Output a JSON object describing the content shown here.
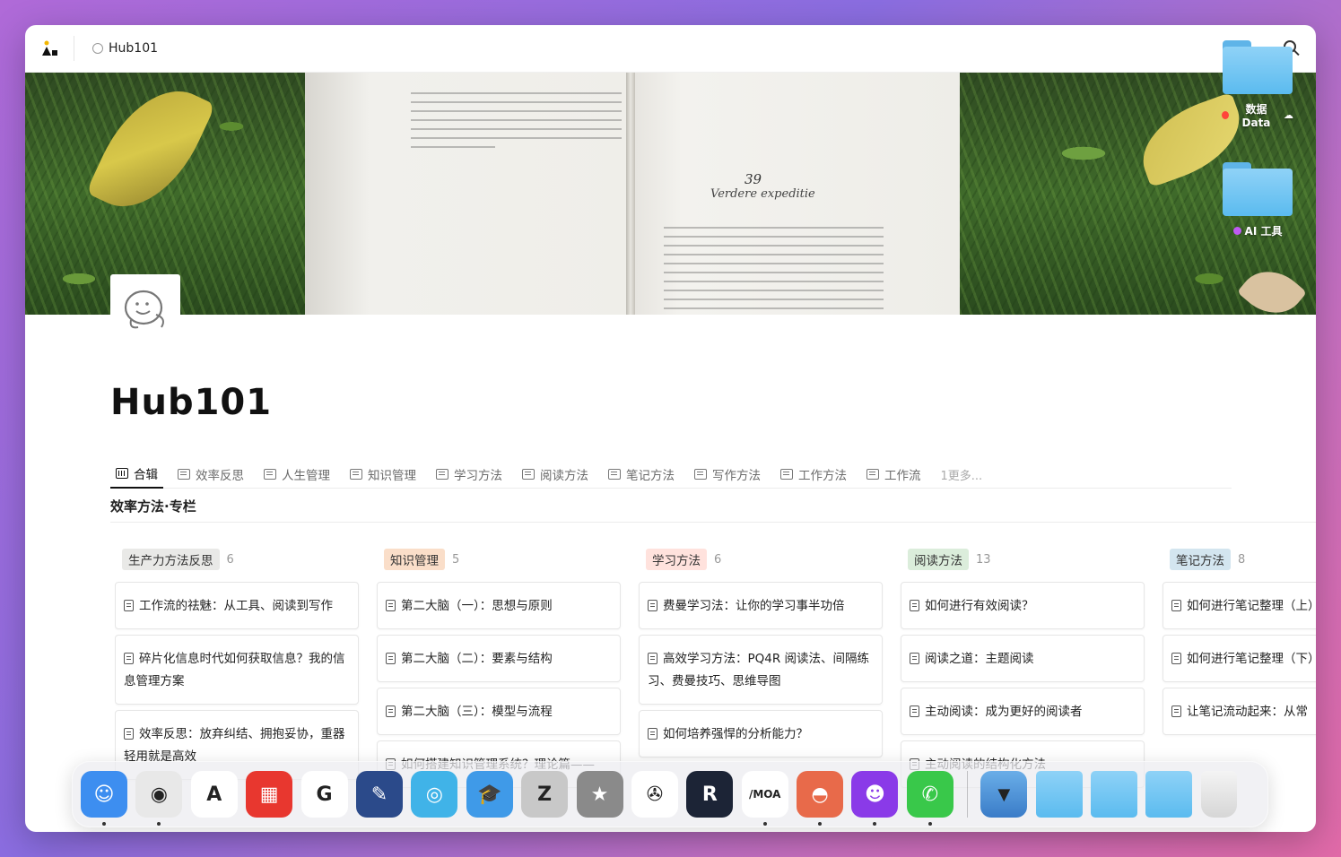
{
  "window": {
    "breadcrumb": "Hub101"
  },
  "page": {
    "title": "Hub101",
    "section_title": "效率方法·专栏"
  },
  "tabs": [
    {
      "label": "合辑",
      "active": true
    },
    {
      "label": "效率反思"
    },
    {
      "label": "人生管理"
    },
    {
      "label": "知识管理"
    },
    {
      "label": "学习方法"
    },
    {
      "label": "阅读方法"
    },
    {
      "label": "笔记方法"
    },
    {
      "label": "写作方法"
    },
    {
      "label": "工作方法"
    },
    {
      "label": "工作流"
    }
  ],
  "tabs_more": "1更多...",
  "cover": {
    "page_number": "39",
    "chapter_title": "Verdere expeditie"
  },
  "columns": [
    {
      "tag": "生产力方法反思",
      "count": "6",
      "color": "#e9e9e7",
      "cards": [
        "工作流的祛魅：从工具、阅读到写作",
        "碎片化信息时代如何获取信息？我的信息管理方案",
        "效率反思：放弃纠结、拥抱妥协，重器轻用就是高效"
      ]
    },
    {
      "tag": "知识管理",
      "count": "5",
      "color": "#fadec9",
      "cards": [
        "第二大脑（一）：思想与原则",
        "第二大脑（二）：要素与结构",
        "第二大脑（三）：模型与流程",
        "如何搭建知识管理系统？理论篇——"
      ]
    },
    {
      "tag": "学习方法",
      "count": "6",
      "color": "#ffe2dd",
      "cards": [
        "费曼学习法：让你的学习事半功倍",
        "高效学习方法：PQ4R 阅读法、间隔练习、费曼技巧、思维导图",
        "如何培养强悍的分析能力？"
      ]
    },
    {
      "tag": "阅读方法",
      "count": "13",
      "color": "#dbeddb",
      "cards": [
        "如何进行有效阅读？",
        "阅读之道：主题阅读",
        "主动阅读：成为更好的阅读者",
        "主动阅读的结构化方法"
      ]
    },
    {
      "tag": "笔记方法",
      "count": "8",
      "color": "#d3e5ef",
      "cards": [
        "如何进行笔记整理（上）记录法",
        "如何进行笔记整理（下）模版",
        "让笔记流动起来：从常"
      ]
    }
  ],
  "desktop": [
    {
      "label": "数据 Data",
      "dot": "#ff453a"
    },
    {
      "label": "AI 工具",
      "dot": "#bf5af2"
    }
  ],
  "dock": [
    {
      "name": "finder-icon",
      "color": "#3d8ef0",
      "glyph": "☺",
      "running": true
    },
    {
      "name": "chrome-icon",
      "color": "#e8e8e8",
      "glyph": "◉",
      "running": true
    },
    {
      "name": "arc-icon",
      "color": "#ffffff",
      "glyph": "A",
      "running": false
    },
    {
      "name": "flomo-icon",
      "color": "#e8372f",
      "glyph": "▦",
      "running": false
    },
    {
      "name": "app-g-icon",
      "color": "#ffffff",
      "glyph": "G",
      "running": false
    },
    {
      "name": "notes-pen-icon",
      "color": "#2b4a8a",
      "glyph": "✎",
      "running": false
    },
    {
      "name": "sync-icon",
      "color": "#40b3e8",
      "glyph": "◎",
      "running": false
    },
    {
      "name": "edu-icon",
      "color": "#3f9ae8",
      "glyph": "🎓",
      "running": false
    },
    {
      "name": "zotero-icon",
      "color": "#c8c8c8",
      "glyph": "Z",
      "running": false
    },
    {
      "name": "photo-star-icon",
      "color": "#8a8a8a",
      "glyph": "★",
      "running": false
    },
    {
      "name": "aperture-icon",
      "color": "#ffffff",
      "glyph": "✇",
      "running": false
    },
    {
      "name": "reeder-icon",
      "color": "#1c2436",
      "glyph": "R",
      "running": false
    },
    {
      "name": "moa-icon",
      "color": "#ffffff",
      "glyph": "/MOA",
      "running": true
    },
    {
      "name": "sunset-icon",
      "color": "#e86a4a",
      "glyph": "◓",
      "running": true
    },
    {
      "name": "bot-icon",
      "color": "#8a3ae8",
      "glyph": "☻",
      "running": true
    },
    {
      "name": "wechat-icon",
      "color": "#39c84a",
      "glyph": "✆",
      "running": true
    }
  ],
  "dock_right": [
    {
      "name": "downloads-tray-icon"
    },
    {
      "name": "folder-icon"
    },
    {
      "name": "folder-icon"
    },
    {
      "name": "folder-icon"
    },
    {
      "name": "trash-icon"
    }
  ]
}
